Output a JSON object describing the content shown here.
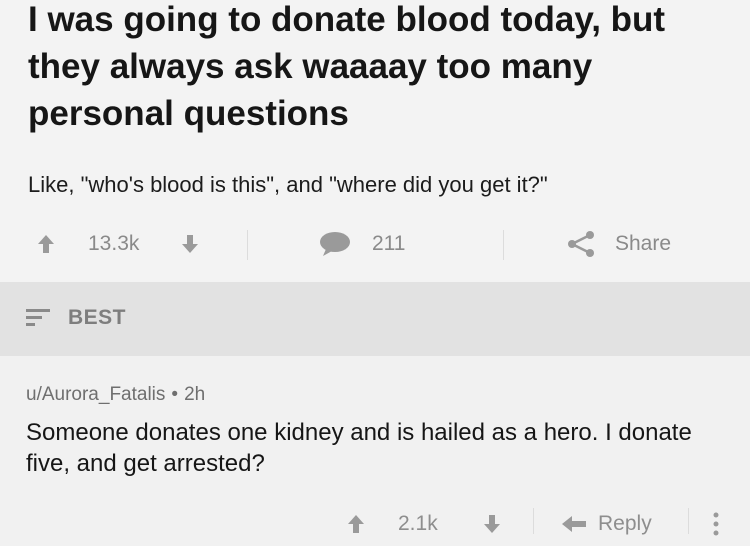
{
  "post": {
    "title": "I was going to donate blood today, but they always ask waaaay too many personal questions",
    "body": "Like, \"who's blood is this\", and \"where did you get it?\"",
    "score": "13.3k",
    "comment_count": "211",
    "share_label": "Share"
  },
  "sort": {
    "label": "BEST",
    "icon": "sort-icon"
  },
  "comment": {
    "author": "u/Aurora_Fatalis",
    "separator": "•",
    "age": "2h",
    "body": "Someone donates one kidney and is hailed as a hero. I donate five, and get arrested?",
    "score": "2.1k",
    "reply_label": "Reply"
  },
  "colors": {
    "background": "#f3f3f3",
    "sort_bar": "#e2e2e2",
    "muted_text": "#8a8a8a",
    "primary_text": "#161616"
  }
}
